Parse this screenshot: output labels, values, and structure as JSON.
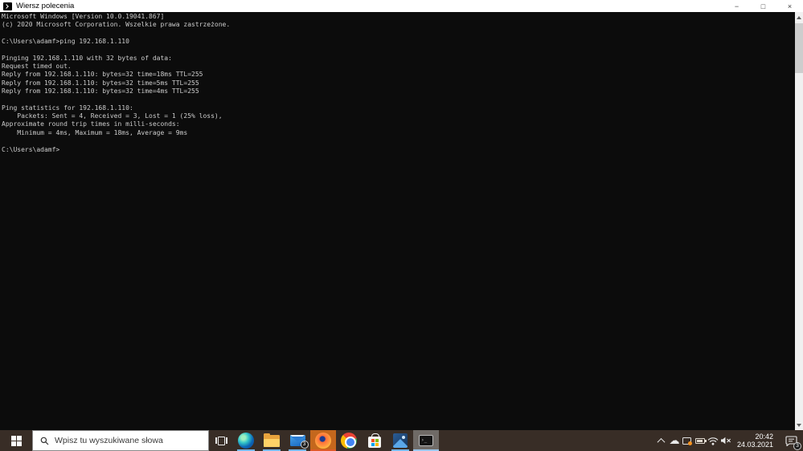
{
  "window": {
    "title": "Wiersz polecenia",
    "controls": {
      "minimize": "−",
      "maximize": "□",
      "close": "×"
    }
  },
  "console": {
    "lines": [
      "Microsoft Windows [Version 10.0.19041.867]",
      "(c) 2020 Microsoft Corporation. Wszelkie prawa zastrzeżone.",
      "",
      "C:\\Users\\adamf>ping 192.168.1.110",
      "",
      "Pinging 192.168.1.110 with 32 bytes of data:",
      "Request timed out.",
      "Reply from 192.168.1.110: bytes=32 time=18ms TTL=255",
      "Reply from 192.168.1.110: bytes=32 time=5ms TTL=255",
      "Reply from 192.168.1.110: bytes=32 time=4ms TTL=255",
      "",
      "Ping statistics for 192.168.1.110:",
      "    Packets: Sent = 4, Received = 3, Lost = 1 (25% loss),",
      "Approximate round trip times in milli-seconds:",
      "    Minimum = 4ms, Maximum = 18ms, Average = 9ms",
      "",
      "C:\\Users\\adamf>"
    ]
  },
  "taskbar": {
    "search": {
      "placeholder": "Wpisz tu wyszukiwane słowa"
    },
    "apps": [
      "task-view",
      "edge",
      "file-explorer",
      "mail",
      "firefox",
      "chrome",
      "microsoft-store",
      "photos",
      "command-prompt"
    ],
    "tray_icons": [
      "chevron-up",
      "onedrive-cloud",
      "display-notification",
      "battery",
      "wifi",
      "volume-muted"
    ],
    "badges": {
      "mail": "3",
      "action_center": "3"
    },
    "clock": {
      "time": "20:42",
      "date": "24.03.2021"
    }
  },
  "colors": {
    "console_bg": "#0c0c0c",
    "console_text": "#cccccc",
    "taskbar_bg": "#382d26",
    "running_indicator": "#76b9ed",
    "firefox_highlight": "#c4671d",
    "notification_dot": "#f7931e"
  }
}
